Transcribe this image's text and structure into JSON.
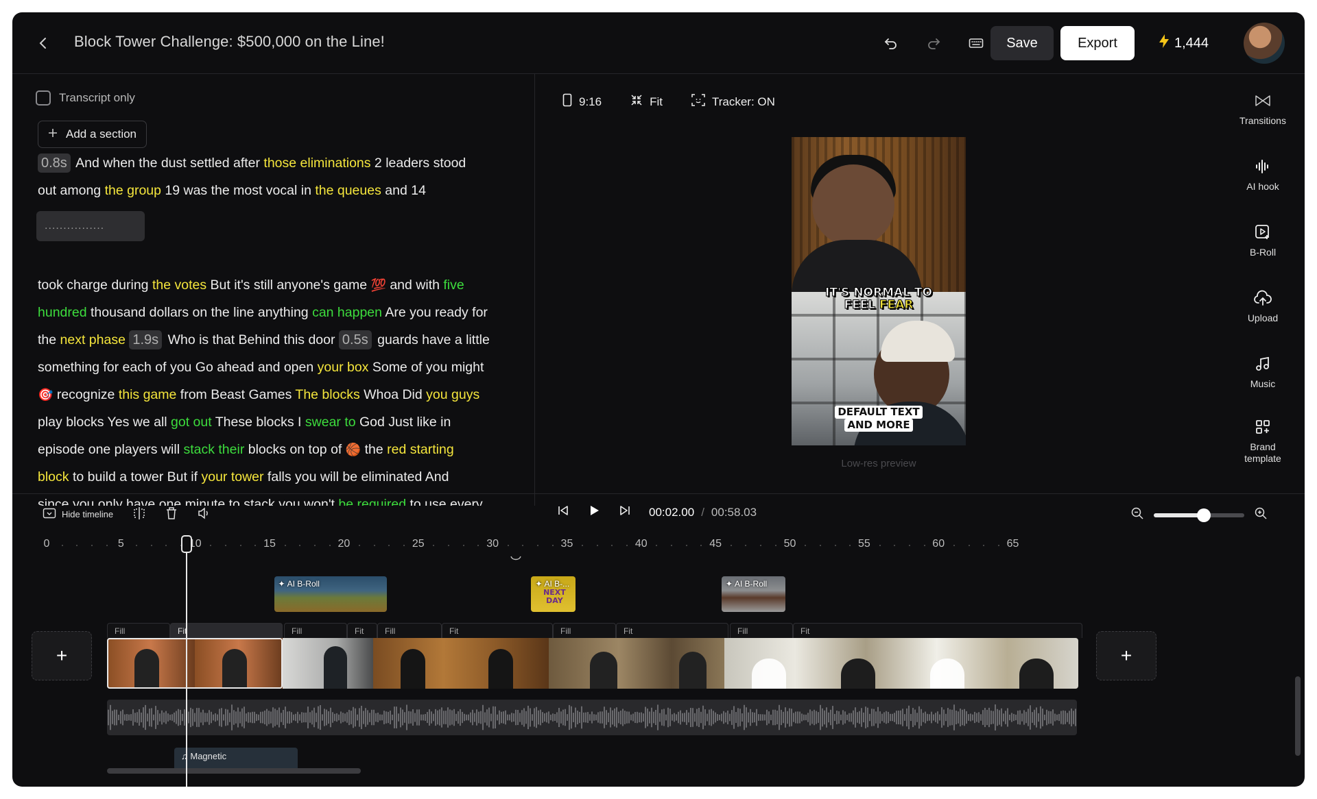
{
  "header": {
    "title": "Block Tower Challenge: $500,000 on the Line!",
    "save_label": "Save",
    "export_label": "Export",
    "credits": "1,444",
    "icons": [
      "back-arrow-icon",
      "undo-icon",
      "redo-icon",
      "keyboard-icon",
      "bolt-icon"
    ]
  },
  "transcript": {
    "transcript_only_label": "Transcript only",
    "add_section_label": "Add a section",
    "dots": "................",
    "lines_a": [
      [
        {
          "t": "0.8s",
          "k": "pause"
        },
        {
          "t": " And when the dust settled after ",
          "k": "n"
        },
        {
          "t": "those eliminations",
          "k": "y"
        },
        {
          "t": " 2 leaders stood",
          "k": "n"
        }
      ],
      [
        {
          "t": "out among ",
          "k": "n"
        },
        {
          "t": "the group",
          "k": "y"
        },
        {
          "t": " 19 was the most vocal in ",
          "k": "n"
        },
        {
          "t": "the queues",
          "k": "y"
        },
        {
          "t": " and 14",
          "k": "n"
        }
      ]
    ],
    "lines_b": [
      [
        {
          "t": "took charge during ",
          "k": "n"
        },
        {
          "t": "the votes",
          "k": "y"
        },
        {
          "t": " But it's still anyone's game ",
          "k": "n"
        },
        {
          "t": "💯",
          "k": "emoji"
        },
        {
          "t": " and with ",
          "k": "n"
        },
        {
          "t": "five",
          "k": "g"
        }
      ],
      [
        {
          "t": "hundred",
          "k": "g"
        },
        {
          "t": " thousand dollars on the line anything ",
          "k": "n"
        },
        {
          "t": "can happen",
          "k": "g"
        },
        {
          "t": " Are you ready for",
          "k": "n"
        }
      ],
      [
        {
          "t": "the ",
          "k": "n"
        },
        {
          "t": "next phase",
          "k": "y"
        },
        {
          "t": " ",
          "k": "n"
        },
        {
          "t": "1.9s",
          "k": "pause"
        },
        {
          "t": " Who is that Behind this door ",
          "k": "n"
        },
        {
          "t": "0.5s",
          "k": "pause"
        },
        {
          "t": " guards have a little",
          "k": "n"
        }
      ],
      [
        {
          "t": "something for each of you Go ahead and open ",
          "k": "n"
        },
        {
          "t": "your box",
          "k": "y"
        },
        {
          "t": " Some of you might",
          "k": "n"
        }
      ],
      [
        {
          "t": "🎯",
          "k": "emoji"
        },
        {
          "t": " recognize ",
          "k": "n"
        },
        {
          "t": "this game",
          "k": "y"
        },
        {
          "t": " from Beast Games ",
          "k": "n"
        },
        {
          "t": "The blocks",
          "k": "y"
        },
        {
          "t": " Whoa Did ",
          "k": "n"
        },
        {
          "t": "you guys",
          "k": "y"
        }
      ],
      [
        {
          "t": "play blocks Yes we all ",
          "k": "n"
        },
        {
          "t": "got out",
          "k": "g"
        },
        {
          "t": " These blocks I ",
          "k": "n"
        },
        {
          "t": "swear to",
          "k": "g"
        },
        {
          "t": " God Just like in",
          "k": "n"
        }
      ],
      [
        {
          "t": "episode one players will ",
          "k": "n"
        },
        {
          "t": "stack their",
          "k": "g"
        },
        {
          "t": " blocks on top of ",
          "k": "n"
        },
        {
          "t": "🏀",
          "k": "emoji"
        },
        {
          "t": " the ",
          "k": "n"
        },
        {
          "t": "red starting",
          "k": "y"
        }
      ],
      [
        {
          "t": "block",
          "k": "y"
        },
        {
          "t": " to build a tower But if ",
          "k": "n"
        },
        {
          "t": "your tower",
          "k": "y"
        },
        {
          "t": " falls you will be eliminated And",
          "k": "n"
        }
      ],
      [
        {
          "t": "since you only have one minute to stack you won't ",
          "k": "n"
        },
        {
          "t": "be required",
          "k": "g"
        },
        {
          "t": " to use every",
          "k": "n"
        }
      ]
    ]
  },
  "preview": {
    "aspect_label": "9:16",
    "fit_label": "Fit",
    "tracker_label": "Tracker: ON",
    "caption_top_line1": "IT'S NORMAL TO",
    "caption_top_line2a": "FEEL ",
    "caption_top_line2b": "FEAR",
    "caption_bottom_line1": "DEFAULT TEXT",
    "caption_bottom_line2": "AND MORE",
    "lowres_label": "Low-res preview"
  },
  "sidebar": {
    "items": [
      {
        "label": "Transitions",
        "icon": "transitions-icon"
      },
      {
        "label": "AI hook",
        "icon": "waveform-icon"
      },
      {
        "label": "B-Roll",
        "icon": "broll-icon"
      },
      {
        "label": "Upload",
        "icon": "upload-cloud-icon"
      },
      {
        "label": "Music",
        "icon": "music-note-icon"
      },
      {
        "label": "Brand template",
        "icon": "template-grid-icon"
      }
    ]
  },
  "timeline": {
    "hide_timeline_label": "Hide timeline",
    "current_time": "00:02.00",
    "separator": "/",
    "total_time": "00:58.03",
    "zoom_level": 0.55,
    "ruler_labels": [
      "0",
      "5",
      "10",
      "15",
      "20",
      "25",
      "30",
      "35",
      "40",
      "45",
      "50",
      "55",
      "60",
      "65"
    ],
    "broll": [
      {
        "label": "AI B-Roll",
        "start_s": 15.3,
        "end_s": 22.9
      },
      {
        "label": "AI B-...",
        "start_s": 32.6,
        "end_s": 35.6,
        "overlay_text": "NEXT DAY"
      },
      {
        "label": "AI B-Roll",
        "start_s": 45.4,
        "end_s": 49.7
      }
    ],
    "clip_fit_labels": [
      "Fill",
      "Fit",
      "Fill",
      "Fit",
      "Fill",
      "Fit",
      "Fill",
      "Fit",
      "Fill",
      "Fit"
    ],
    "music_label": "Magnetic",
    "playhead_s": 8.0
  }
}
